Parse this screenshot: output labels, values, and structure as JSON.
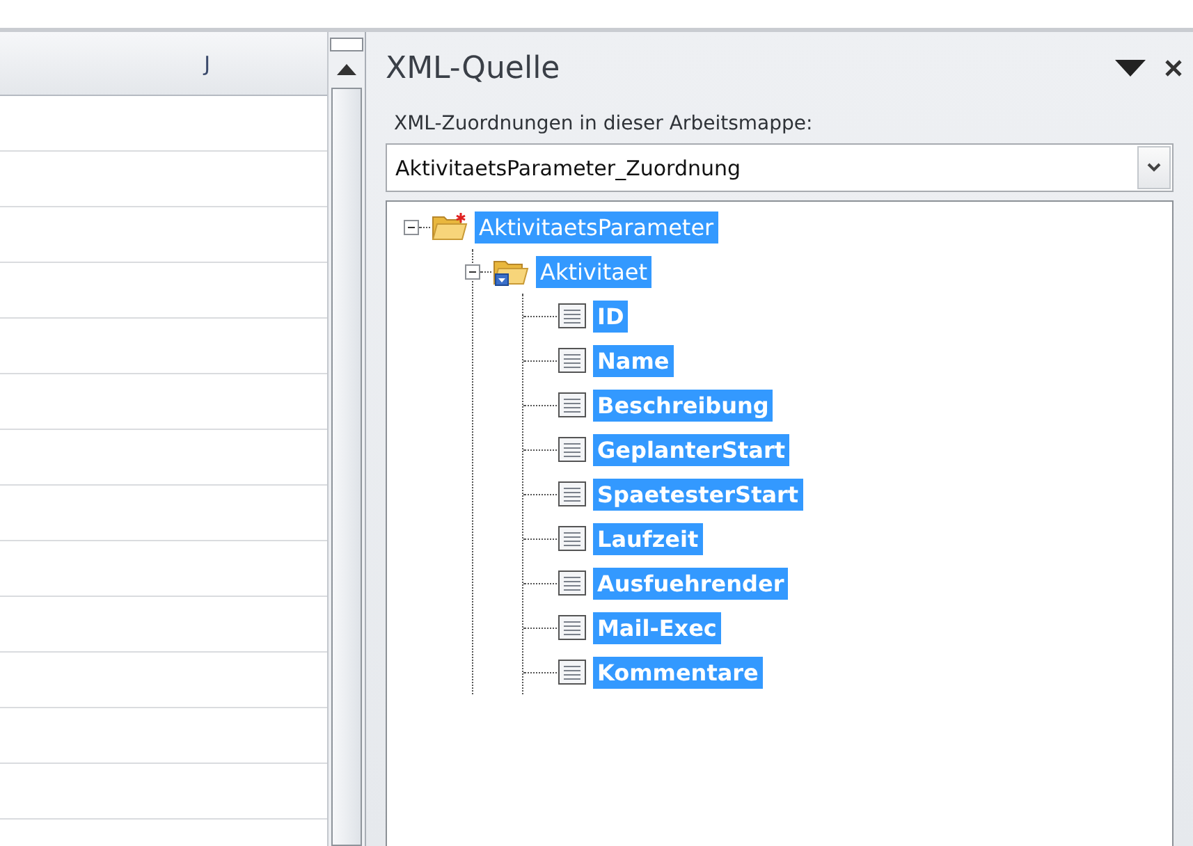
{
  "sheet": {
    "column_header": "J"
  },
  "xml_source_pane": {
    "title": "XML-Quelle",
    "maps_label": "XML-Zuordnungen in dieser Arbeitsmappe:",
    "map_dropdown": {
      "value": "AktivitaetsParameter_Zuordnung"
    },
    "tree": [
      {
        "label": "AktivitaetsParameter",
        "kind": "root",
        "expanded": true,
        "selected": true,
        "children": [
          {
            "label": "Aktivitaet",
            "kind": "repeating",
            "expanded": true,
            "selected": true,
            "children": [
              {
                "label": "ID",
                "kind": "element",
                "selected": true
              },
              {
                "label": "Name",
                "kind": "element",
                "selected": true
              },
              {
                "label": "Beschreibung",
                "kind": "element",
                "selected": true
              },
              {
                "label": "GeplanterStart",
                "kind": "element",
                "selected": true
              },
              {
                "label": "SpaetesterStart",
                "kind": "element",
                "selected": true
              },
              {
                "label": "Laufzeit",
                "kind": "element",
                "selected": true
              },
              {
                "label": "Ausfuehrender",
                "kind": "element",
                "selected": true
              },
              {
                "label": "Mail-Exec",
                "kind": "element",
                "selected": true
              },
              {
                "label": "Kommentare",
                "kind": "element",
                "selected": true
              }
            ]
          }
        ]
      }
    ]
  }
}
